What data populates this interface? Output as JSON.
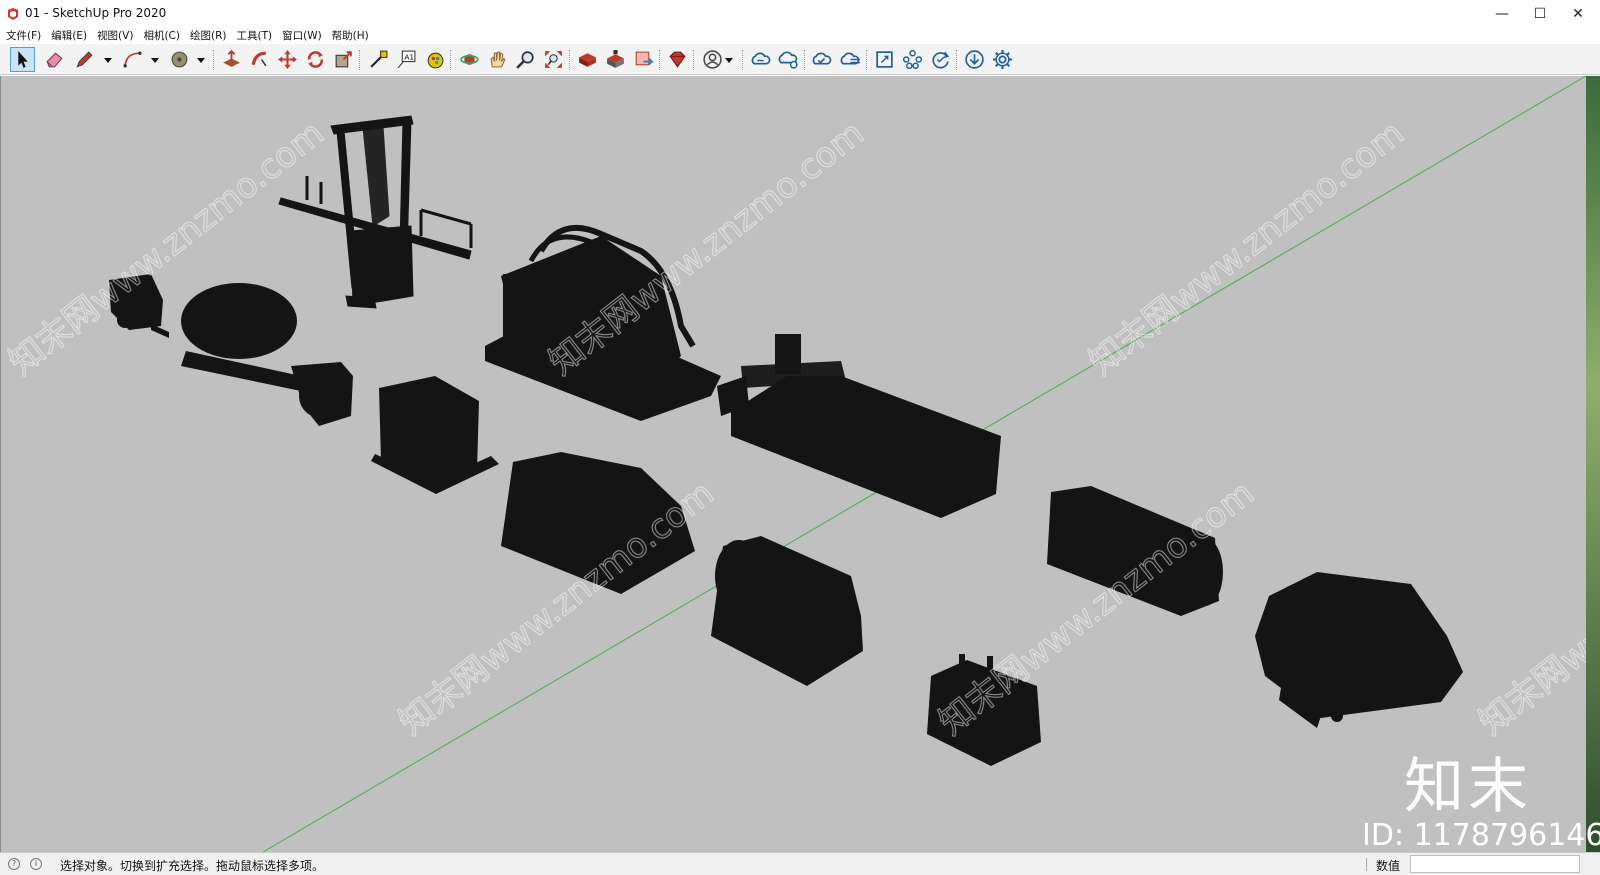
{
  "window": {
    "title": "01 - SketchUp Pro 2020",
    "minimize_glyph": "—",
    "maximize_glyph": "☐",
    "close_glyph": "✕"
  },
  "menu": {
    "items": [
      {
        "label": "文件(F)"
      },
      {
        "label": "编辑(E)"
      },
      {
        "label": "视图(V)"
      },
      {
        "label": "相机(C)"
      },
      {
        "label": "绘图(R)"
      },
      {
        "label": "工具(T)"
      },
      {
        "label": "窗口(W)"
      },
      {
        "label": "帮助(H)"
      }
    ]
  },
  "toolbar": {
    "tools": [
      {
        "icon": "select-arrow-icon",
        "selected": true
      },
      {
        "icon": "eraser-icon"
      },
      {
        "icon": "pencil-icon",
        "dropdown": true
      },
      {
        "icon": "arc-icon",
        "dropdown": true
      },
      {
        "icon": "paint-bucket-icon",
        "dropdown": true
      },
      {
        "icon": "push-pull-icon"
      },
      {
        "icon": "follow-me-icon"
      },
      {
        "icon": "move-icon"
      },
      {
        "icon": "rotate-icon"
      },
      {
        "icon": "scale-icon"
      },
      {
        "icon": "tape-measure-icon"
      },
      {
        "icon": "text-icon"
      },
      {
        "icon": "paint-icon"
      },
      {
        "icon": "orbit-icon"
      },
      {
        "icon": "pan-icon"
      },
      {
        "icon": "zoom-icon"
      },
      {
        "icon": "zoom-extents-icon"
      },
      {
        "icon": "warehouse-icon"
      },
      {
        "icon": "extension-warehouse-icon"
      },
      {
        "icon": "send-to-layout-icon"
      },
      {
        "icon": "ruby-extension-icon"
      },
      {
        "icon": "account-icon",
        "dropdown": true
      },
      {
        "icon": "cloud-sync-icon"
      },
      {
        "icon": "cloud-share-icon"
      },
      {
        "icon": "cloud-check-icon"
      },
      {
        "icon": "cloud-list-icon"
      },
      {
        "icon": "section-frame-icon"
      },
      {
        "icon": "components-icon"
      },
      {
        "icon": "refresh-check-icon"
      },
      {
        "icon": "download-icon"
      },
      {
        "icon": "settings-gear-icon"
      }
    ]
  },
  "viewport": {
    "background": "#c0c0c0",
    "axis_color": "#4caf50",
    "watermark_text": "知末网www.znzmo.com",
    "brand_logo": "知末",
    "brand_id": "ID: 1178796146"
  },
  "status": {
    "message": "选择对象。切换到扩充选择。拖动鼠标选择多项。",
    "measurements_label": "数值",
    "measurements_value": ""
  }
}
